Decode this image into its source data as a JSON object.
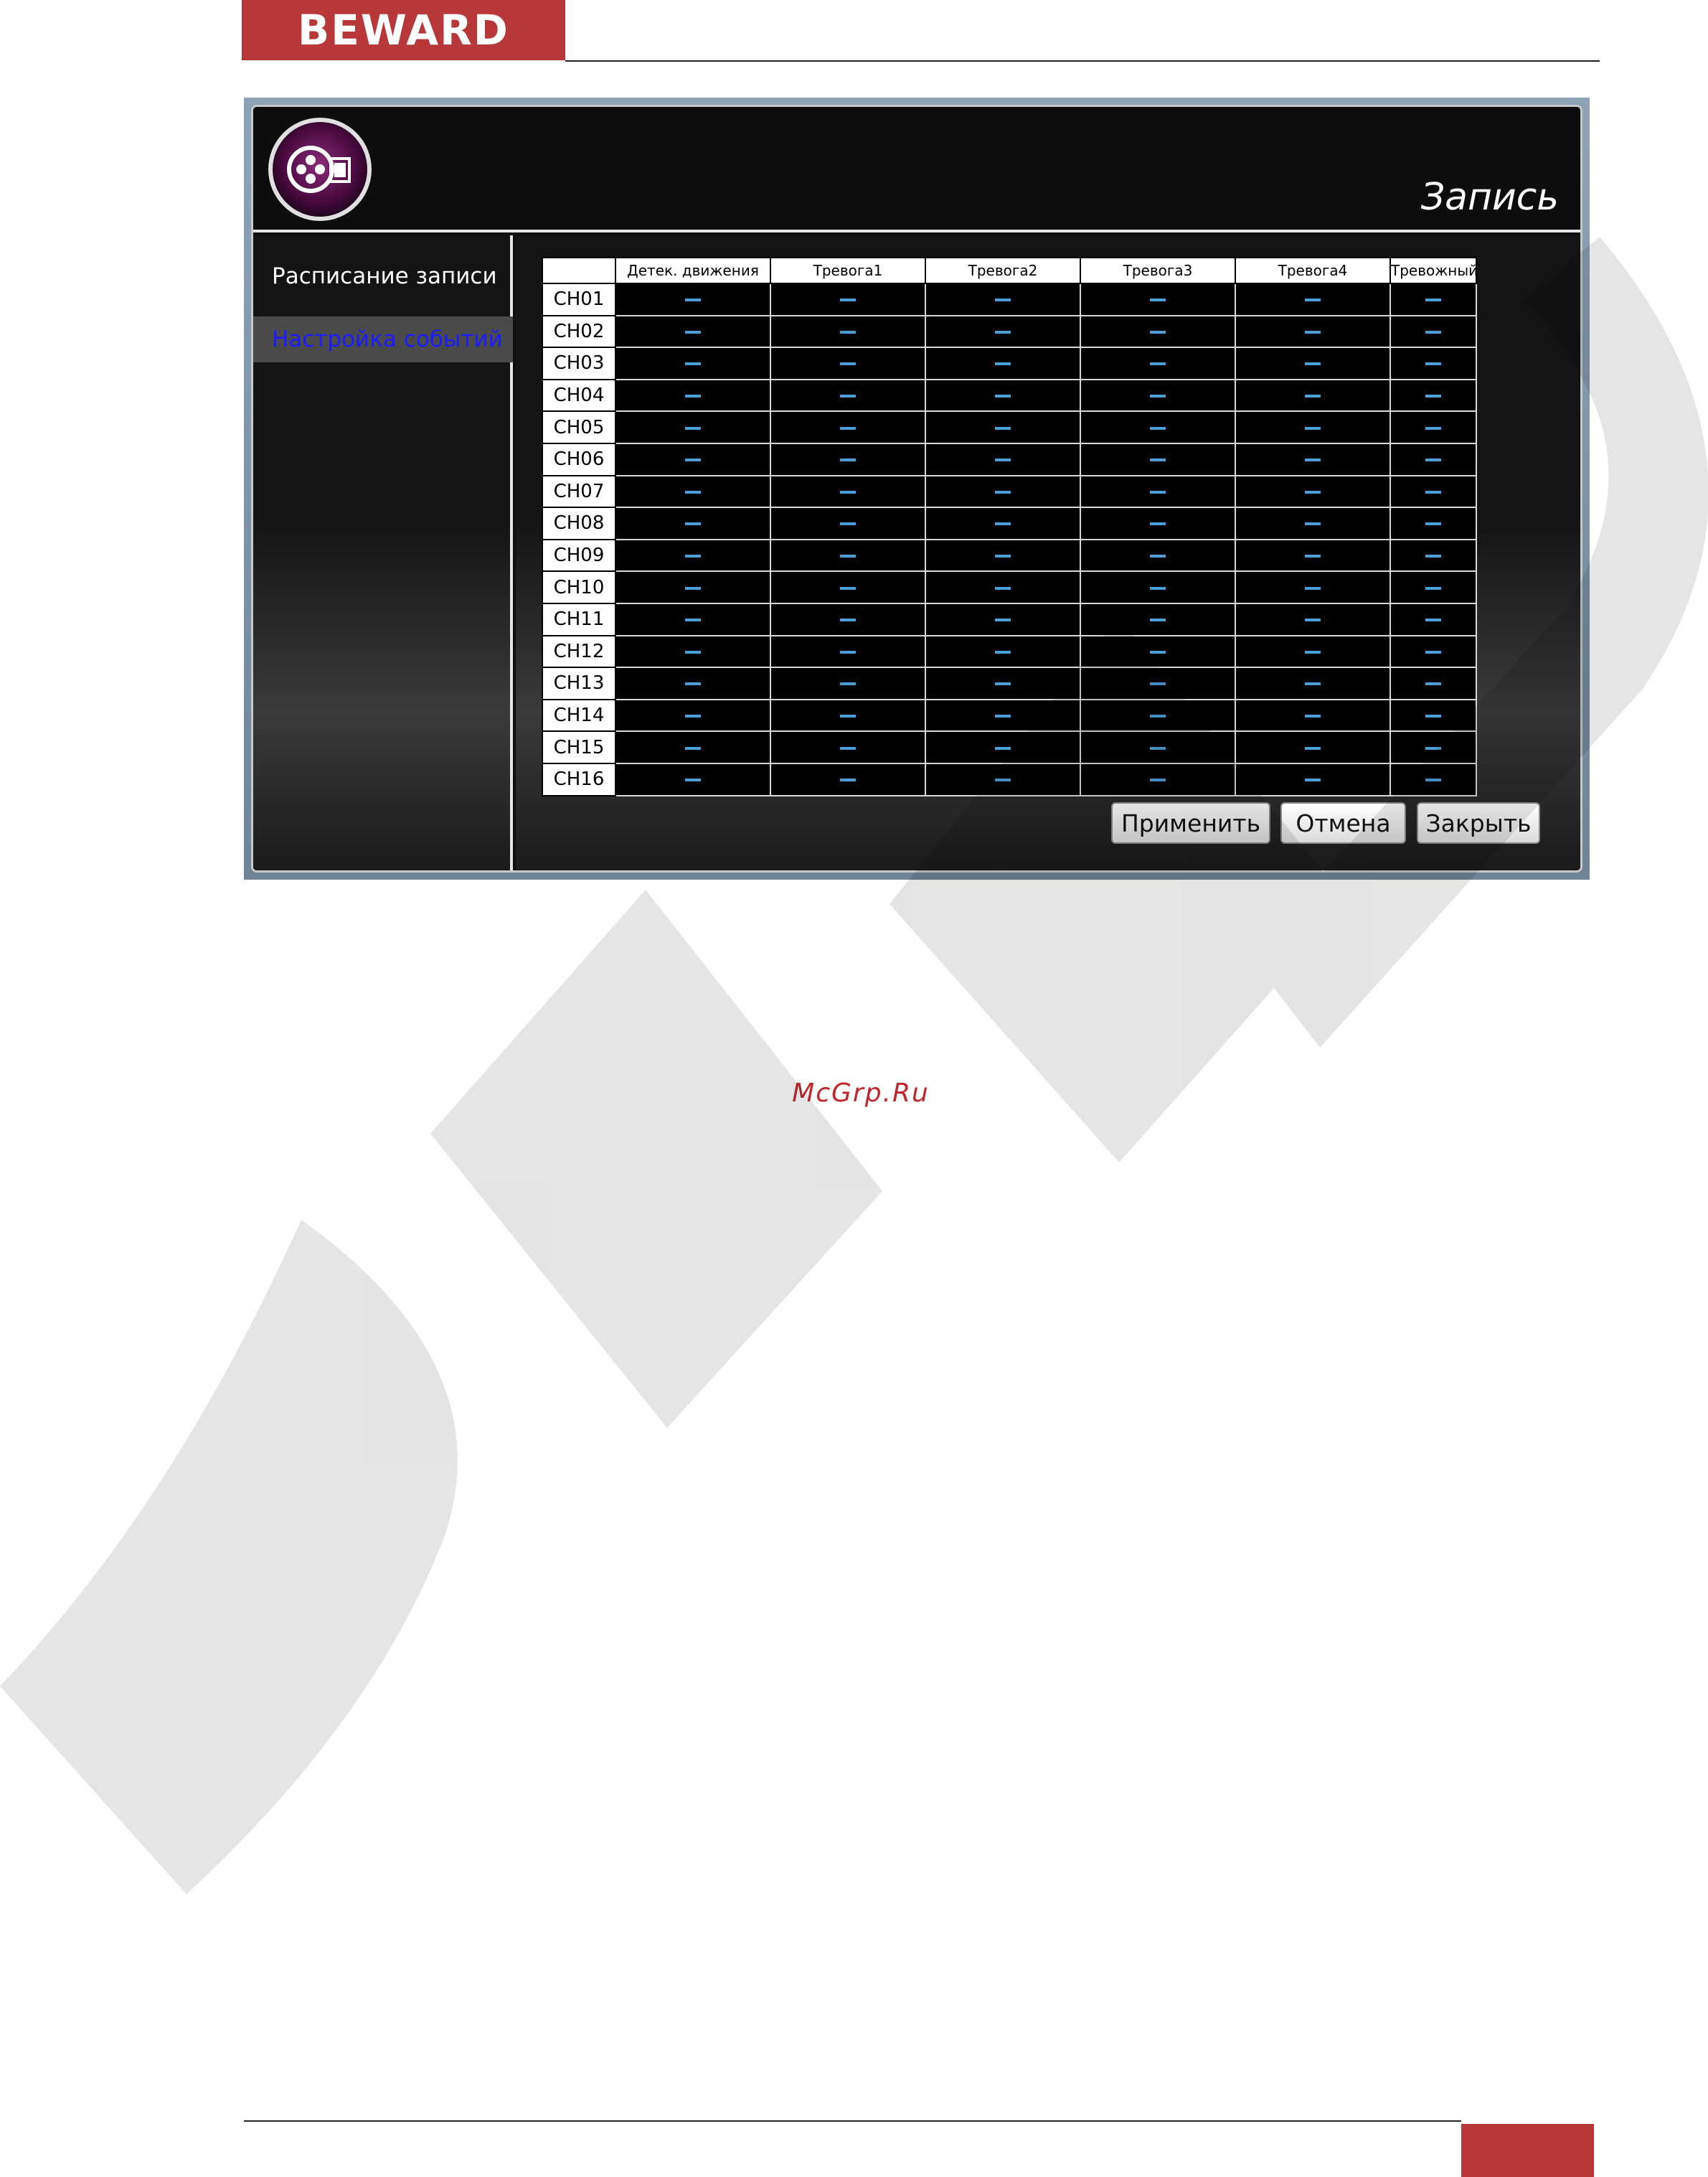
{
  "brand": {
    "logo_text": "BEWARD"
  },
  "window": {
    "title": "Запись",
    "icon": "film-reel-icon"
  },
  "sidebar": {
    "items": [
      {
        "label": "Расписание записи",
        "active": false
      },
      {
        "label": "Настройка событий",
        "active": true
      }
    ]
  },
  "table": {
    "columns": [
      "Детек. движения",
      "Тревога1",
      "Тревога2",
      "Тревога3",
      "Тревога4",
      "Тревожный выход"
    ],
    "rows": [
      "CH01",
      "CH02",
      "CH03",
      "CH04",
      "CH05",
      "CH06",
      "CH07",
      "CH08",
      "CH09",
      "CH10",
      "CH11",
      "CH12",
      "CH13",
      "CH14",
      "CH15",
      "CH16"
    ],
    "cell_value": "—"
  },
  "buttons": {
    "apply": "Применить",
    "cancel": "Отмена",
    "close": "Закрыть"
  },
  "site_link": "McGrp.Ru",
  "colors": {
    "brand": "#b8383a",
    "accent_dash": "#4a9fd8",
    "active_link": "#1a1aff"
  }
}
